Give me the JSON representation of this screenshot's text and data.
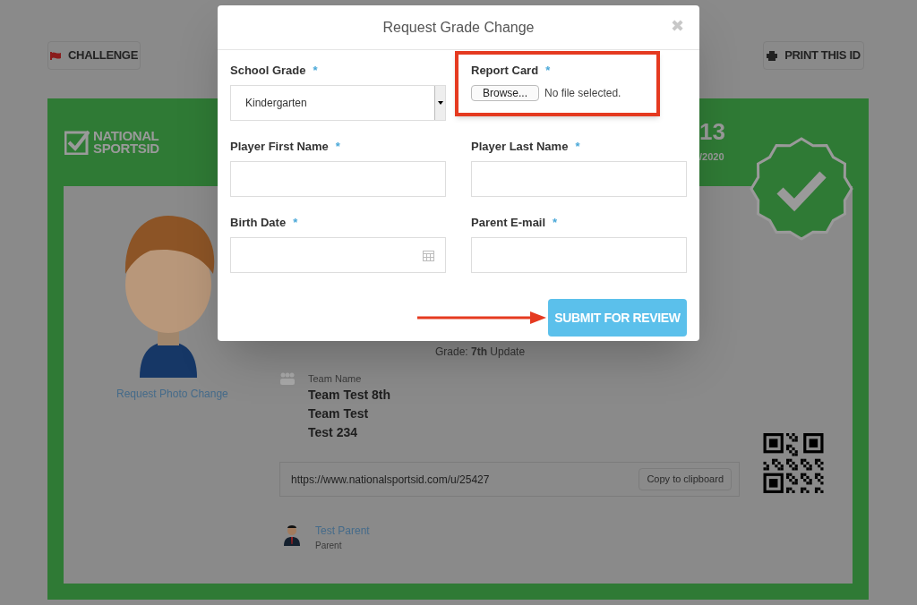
{
  "toolbar": {
    "challenge_button": "CHALLENGE",
    "print_button": "PRINT THIS ID"
  },
  "id_card": {
    "logo_lines": [
      "NATIONAL",
      "SPORTSID"
    ],
    "number": "13",
    "date": "/2020",
    "verified": true,
    "photo_link": "Request Photo Change",
    "grade": "Grade: **7th** Update",
    "team_label": "Team Name",
    "teams": [
      "Team Test 8th",
      "Team Test",
      "Test 234"
    ],
    "url": "https://www.nationalsportsid.com/u/25427",
    "copy_button": "Copy to clipboard",
    "parent": {
      "name": "Test Parent",
      "role": "Parent"
    }
  },
  "modal": {
    "title": "Request Grade Change",
    "close": "✖",
    "fields": [
      {
        "kind": "select",
        "label": "School Grade",
        "required_mark": "*",
        "value": "Kindergarten"
      },
      {
        "kind": "file",
        "label": "Report Card",
        "required_mark": "*",
        "button": "Browse...",
        "status": "No file selected.",
        "highlighted": true
      },
      {
        "kind": "text",
        "label": "Player First Name",
        "required_mark": "*"
      },
      {
        "kind": "text",
        "label": "Player Last Name",
        "required_mark": "*"
      },
      {
        "kind": "date",
        "label": "Birth Date",
        "required_mark": "*"
      },
      {
        "kind": "text",
        "label": "Parent E-mail",
        "required_mark": "*"
      }
    ],
    "submit_button": "SUBMIT FOR REVIEW",
    "submit_arrow": true
  }
}
